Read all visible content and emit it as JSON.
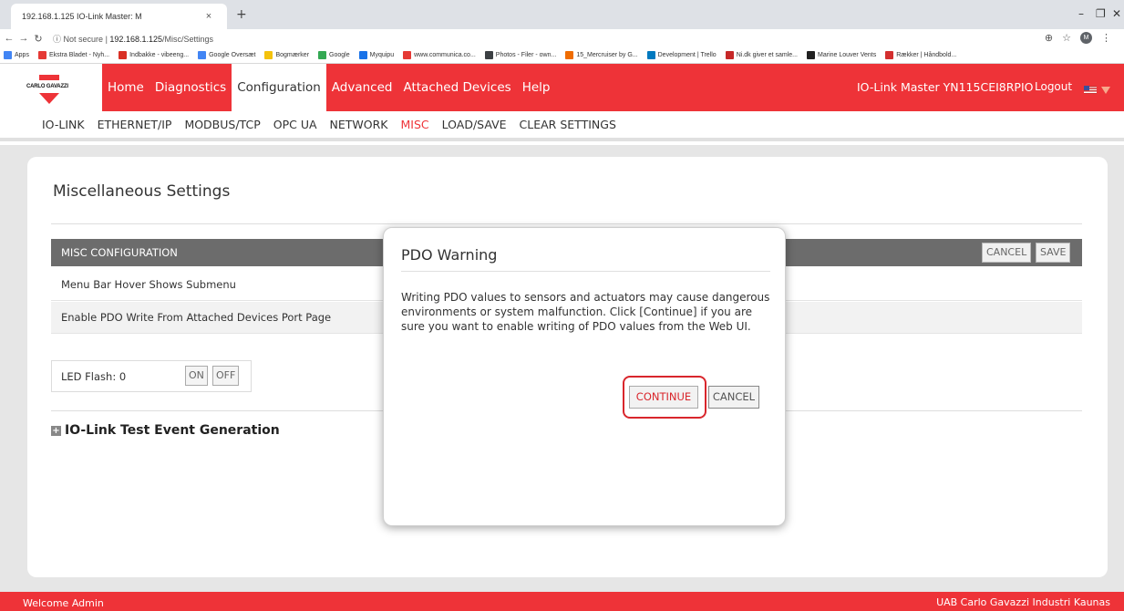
{
  "browser": {
    "tab_title": "192.168.1.125 IO-Link Master: M",
    "tab_close": "×",
    "new_tab": "+",
    "security": "Not secure",
    "url_host": "192.168.1.125",
    "url_path": "/Misc/Settings",
    "bookmarks": [
      {
        "label": "Apps",
        "color": "#4285f4"
      },
      {
        "label": "Ekstra Bladet - Nyh...",
        "color": "#e53935"
      },
      {
        "label": "Indbakke - vibeeng...",
        "color": "#d93025"
      },
      {
        "label": "Google Oversæt",
        "color": "#4285f4"
      },
      {
        "label": "Bogmærker",
        "color": "#f4c20d"
      },
      {
        "label": "Google",
        "color": "#34a853"
      },
      {
        "label": "Myquipu",
        "color": "#1a73e8"
      },
      {
        "label": "www.communica.co...",
        "color": "#e53935"
      },
      {
        "label": "Photos - Filer - own...",
        "color": "#3c4043"
      },
      {
        "label": "15_Mercruiser by G...",
        "color": "#ef6c00"
      },
      {
        "label": "Development | Trello",
        "color": "#0079bf"
      },
      {
        "label": "Ni.dk giver et samle...",
        "color": "#c62828"
      },
      {
        "label": "Marine Louver Vents",
        "color": "#212121"
      },
      {
        "label": "Rækker | Håndbold...",
        "color": "#d32f2f"
      }
    ]
  },
  "header": {
    "logo_text": "CARLO GAVAZZI",
    "nav": [
      "Home",
      "Diagnostics",
      "Configuration",
      "Advanced",
      "Attached Devices",
      "Help"
    ],
    "active_nav": "Configuration",
    "device_name": "IO-Link Master YN115CEI8RPIO",
    "logout": "Logout",
    "brand_color": "#ee3338"
  },
  "subnav": {
    "items": [
      "IO-LINK",
      "ETHERNET/IP",
      "MODBUS/TCP",
      "OPC UA",
      "NETWORK",
      "MISC",
      "LOAD/SAVE",
      "CLEAR SETTINGS"
    ],
    "active": "MISC"
  },
  "page": {
    "title": "Miscellaneous Settings",
    "config_header": "MISC CONFIGURATION",
    "cancel_label": "CANCEL",
    "save_label": "SAVE",
    "rows": [
      "Menu Bar Hover Shows Submenu",
      "Enable PDO Write From Attached Devices Port Page"
    ],
    "led_label": "LED Flash: 0",
    "on_label": "ON",
    "off_label": "OFF",
    "event_section": "IO-Link Test Event Generation"
  },
  "modal": {
    "title": "PDO Warning",
    "body": "Writing PDO values to sensors and actuators may cause dangerous environments or system malfunction. Click [Continue] if you are sure you want to enable writing of PDO values from the Web UI.",
    "continue_label": "CONTINUE",
    "cancel_label": "CANCEL"
  },
  "footer": {
    "left": "Welcome Admin",
    "right": "UAB Carlo Gavazzi Industri Kaunas"
  }
}
